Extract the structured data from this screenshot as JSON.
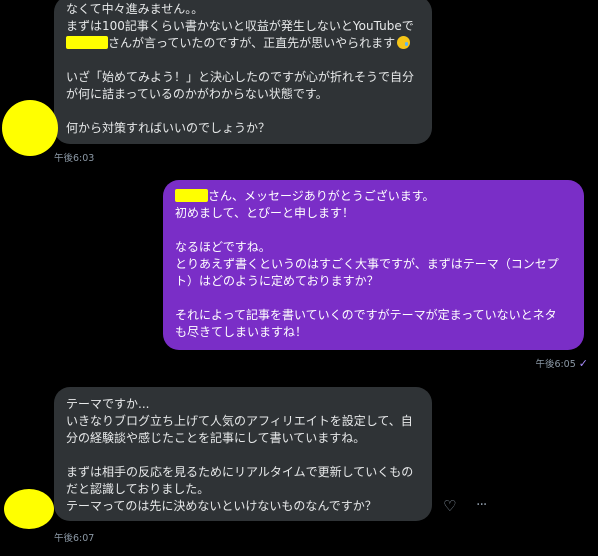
{
  "messages": [
    {
      "id": "m1",
      "lines": [
        "なくて中々進みません。。",
        "まずは100記事くらい書かないと収益が発生しないとYouTubeで",
        "さんが言っていたのですが、正直先が思いやられます",
        "",
        "いざ「始めてみよう！」と決心したのですが心が折れそうで自分",
        "が何に詰まっているのかがわからない状態です。",
        "",
        "何から対策すればいいのでしょうか？"
      ],
      "time": "午後6:03"
    },
    {
      "id": "m2",
      "lines": [
        "さん、メッセージありがとうございます。",
        "初めまして、とぴーと申します！",
        "",
        "なるほどですね。",
        "とりあえず書くというのはすごく大事ですが、まずはテーマ（コンセプ",
        "ト）はどのように定めておりますか？",
        "",
        "それによって記事を書いていくのですがテーマが定まっていないとネタ",
        "も尽きてしまいますね！"
      ],
      "time": "午後6:05",
      "status_icon": "check-icon"
    },
    {
      "id": "m3",
      "lines": [
        "テーマですか...",
        "いきなりブログ立ち上げて人気のアフィリエイトを設定して、自",
        "分の経験談や感じたことを記事にして書いていますね。",
        "",
        "まずは相手の反応を見るためにリアルタイムで更新していくもの",
        "だと認識しておりました。",
        "テーマってのは先に決めないといけないものなんですか？"
      ],
      "time": "午後6:07"
    }
  ],
  "actions": {
    "react_icon": "heart-plus-icon",
    "more_icon": "more-icon",
    "react_glyph": "♡",
    "more_glyph": "···"
  },
  "colors": {
    "background": "#000000",
    "received_bubble": "#2f3336",
    "sent_bubble": "#7a2ec7",
    "redaction": "#ffff00",
    "timestamp": "#8b98a5"
  }
}
